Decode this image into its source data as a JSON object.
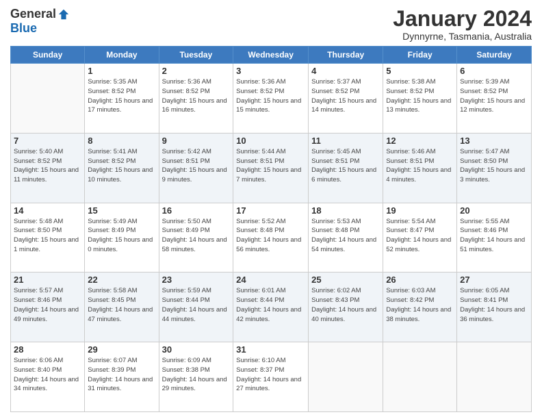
{
  "logo": {
    "general": "General",
    "blue": "Blue"
  },
  "title": "January 2024",
  "subtitle": "Dynnyrne, Tasmania, Australia",
  "days_of_week": [
    "Sunday",
    "Monday",
    "Tuesday",
    "Wednesday",
    "Thursday",
    "Friday",
    "Saturday"
  ],
  "weeks": [
    [
      {
        "day": "",
        "sunrise": "",
        "sunset": "",
        "daylight": ""
      },
      {
        "day": "1",
        "sunrise": "Sunrise: 5:35 AM",
        "sunset": "Sunset: 8:52 PM",
        "daylight": "Daylight: 15 hours and 17 minutes."
      },
      {
        "day": "2",
        "sunrise": "Sunrise: 5:36 AM",
        "sunset": "Sunset: 8:52 PM",
        "daylight": "Daylight: 15 hours and 16 minutes."
      },
      {
        "day": "3",
        "sunrise": "Sunrise: 5:36 AM",
        "sunset": "Sunset: 8:52 PM",
        "daylight": "Daylight: 15 hours and 15 minutes."
      },
      {
        "day": "4",
        "sunrise": "Sunrise: 5:37 AM",
        "sunset": "Sunset: 8:52 PM",
        "daylight": "Daylight: 15 hours and 14 minutes."
      },
      {
        "day": "5",
        "sunrise": "Sunrise: 5:38 AM",
        "sunset": "Sunset: 8:52 PM",
        "daylight": "Daylight: 15 hours and 13 minutes."
      },
      {
        "day": "6",
        "sunrise": "Sunrise: 5:39 AM",
        "sunset": "Sunset: 8:52 PM",
        "daylight": "Daylight: 15 hours and 12 minutes."
      }
    ],
    [
      {
        "day": "7",
        "sunrise": "Sunrise: 5:40 AM",
        "sunset": "Sunset: 8:52 PM",
        "daylight": "Daylight: 15 hours and 11 minutes."
      },
      {
        "day": "8",
        "sunrise": "Sunrise: 5:41 AM",
        "sunset": "Sunset: 8:52 PM",
        "daylight": "Daylight: 15 hours and 10 minutes."
      },
      {
        "day": "9",
        "sunrise": "Sunrise: 5:42 AM",
        "sunset": "Sunset: 8:51 PM",
        "daylight": "Daylight: 15 hours and 9 minutes."
      },
      {
        "day": "10",
        "sunrise": "Sunrise: 5:44 AM",
        "sunset": "Sunset: 8:51 PM",
        "daylight": "Daylight: 15 hours and 7 minutes."
      },
      {
        "day": "11",
        "sunrise": "Sunrise: 5:45 AM",
        "sunset": "Sunset: 8:51 PM",
        "daylight": "Daylight: 15 hours and 6 minutes."
      },
      {
        "day": "12",
        "sunrise": "Sunrise: 5:46 AM",
        "sunset": "Sunset: 8:51 PM",
        "daylight": "Daylight: 15 hours and 4 minutes."
      },
      {
        "day": "13",
        "sunrise": "Sunrise: 5:47 AM",
        "sunset": "Sunset: 8:50 PM",
        "daylight": "Daylight: 15 hours and 3 minutes."
      }
    ],
    [
      {
        "day": "14",
        "sunrise": "Sunrise: 5:48 AM",
        "sunset": "Sunset: 8:50 PM",
        "daylight": "Daylight: 15 hours and 1 minute."
      },
      {
        "day": "15",
        "sunrise": "Sunrise: 5:49 AM",
        "sunset": "Sunset: 8:49 PM",
        "daylight": "Daylight: 15 hours and 0 minutes."
      },
      {
        "day": "16",
        "sunrise": "Sunrise: 5:50 AM",
        "sunset": "Sunset: 8:49 PM",
        "daylight": "Daylight: 14 hours and 58 minutes."
      },
      {
        "day": "17",
        "sunrise": "Sunrise: 5:52 AM",
        "sunset": "Sunset: 8:48 PM",
        "daylight": "Daylight: 14 hours and 56 minutes."
      },
      {
        "day": "18",
        "sunrise": "Sunrise: 5:53 AM",
        "sunset": "Sunset: 8:48 PM",
        "daylight": "Daylight: 14 hours and 54 minutes."
      },
      {
        "day": "19",
        "sunrise": "Sunrise: 5:54 AM",
        "sunset": "Sunset: 8:47 PM",
        "daylight": "Daylight: 14 hours and 52 minutes."
      },
      {
        "day": "20",
        "sunrise": "Sunrise: 5:55 AM",
        "sunset": "Sunset: 8:46 PM",
        "daylight": "Daylight: 14 hours and 51 minutes."
      }
    ],
    [
      {
        "day": "21",
        "sunrise": "Sunrise: 5:57 AM",
        "sunset": "Sunset: 8:46 PM",
        "daylight": "Daylight: 14 hours and 49 minutes."
      },
      {
        "day": "22",
        "sunrise": "Sunrise: 5:58 AM",
        "sunset": "Sunset: 8:45 PM",
        "daylight": "Daylight: 14 hours and 47 minutes."
      },
      {
        "day": "23",
        "sunrise": "Sunrise: 5:59 AM",
        "sunset": "Sunset: 8:44 PM",
        "daylight": "Daylight: 14 hours and 44 minutes."
      },
      {
        "day": "24",
        "sunrise": "Sunrise: 6:01 AM",
        "sunset": "Sunset: 8:44 PM",
        "daylight": "Daylight: 14 hours and 42 minutes."
      },
      {
        "day": "25",
        "sunrise": "Sunrise: 6:02 AM",
        "sunset": "Sunset: 8:43 PM",
        "daylight": "Daylight: 14 hours and 40 minutes."
      },
      {
        "day": "26",
        "sunrise": "Sunrise: 6:03 AM",
        "sunset": "Sunset: 8:42 PM",
        "daylight": "Daylight: 14 hours and 38 minutes."
      },
      {
        "day": "27",
        "sunrise": "Sunrise: 6:05 AM",
        "sunset": "Sunset: 8:41 PM",
        "daylight": "Daylight: 14 hours and 36 minutes."
      }
    ],
    [
      {
        "day": "28",
        "sunrise": "Sunrise: 6:06 AM",
        "sunset": "Sunset: 8:40 PM",
        "daylight": "Daylight: 14 hours and 34 minutes."
      },
      {
        "day": "29",
        "sunrise": "Sunrise: 6:07 AM",
        "sunset": "Sunset: 8:39 PM",
        "daylight": "Daylight: 14 hours and 31 minutes."
      },
      {
        "day": "30",
        "sunrise": "Sunrise: 6:09 AM",
        "sunset": "Sunset: 8:38 PM",
        "daylight": "Daylight: 14 hours and 29 minutes."
      },
      {
        "day": "31",
        "sunrise": "Sunrise: 6:10 AM",
        "sunset": "Sunset: 8:37 PM",
        "daylight": "Daylight: 14 hours and 27 minutes."
      },
      {
        "day": "",
        "sunrise": "",
        "sunset": "",
        "daylight": ""
      },
      {
        "day": "",
        "sunrise": "",
        "sunset": "",
        "daylight": ""
      },
      {
        "day": "",
        "sunrise": "",
        "sunset": "",
        "daylight": ""
      }
    ]
  ]
}
